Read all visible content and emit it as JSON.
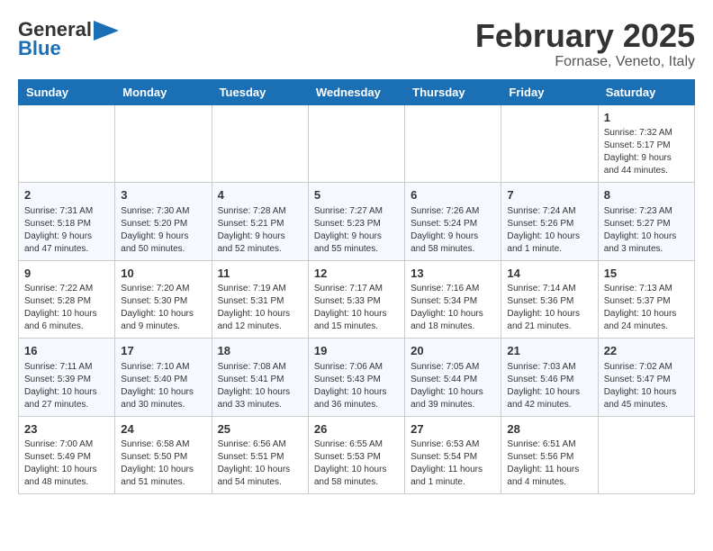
{
  "header": {
    "logo_line1": "General",
    "logo_line2": "Blue",
    "title": "February 2025",
    "subtitle": "Fornase, Veneto, Italy"
  },
  "calendar": {
    "days_of_week": [
      "Sunday",
      "Monday",
      "Tuesday",
      "Wednesday",
      "Thursday",
      "Friday",
      "Saturday"
    ],
    "weeks": [
      [
        {
          "day": "",
          "info": ""
        },
        {
          "day": "",
          "info": ""
        },
        {
          "day": "",
          "info": ""
        },
        {
          "day": "",
          "info": ""
        },
        {
          "day": "",
          "info": ""
        },
        {
          "day": "",
          "info": ""
        },
        {
          "day": "1",
          "info": "Sunrise: 7:32 AM\nSunset: 5:17 PM\nDaylight: 9 hours and 44 minutes."
        }
      ],
      [
        {
          "day": "2",
          "info": "Sunrise: 7:31 AM\nSunset: 5:18 PM\nDaylight: 9 hours and 47 minutes."
        },
        {
          "day": "3",
          "info": "Sunrise: 7:30 AM\nSunset: 5:20 PM\nDaylight: 9 hours and 50 minutes."
        },
        {
          "day": "4",
          "info": "Sunrise: 7:28 AM\nSunset: 5:21 PM\nDaylight: 9 hours and 52 minutes."
        },
        {
          "day": "5",
          "info": "Sunrise: 7:27 AM\nSunset: 5:23 PM\nDaylight: 9 hours and 55 minutes."
        },
        {
          "day": "6",
          "info": "Sunrise: 7:26 AM\nSunset: 5:24 PM\nDaylight: 9 hours and 58 minutes."
        },
        {
          "day": "7",
          "info": "Sunrise: 7:24 AM\nSunset: 5:26 PM\nDaylight: 10 hours and 1 minute."
        },
        {
          "day": "8",
          "info": "Sunrise: 7:23 AM\nSunset: 5:27 PM\nDaylight: 10 hours and 3 minutes."
        }
      ],
      [
        {
          "day": "9",
          "info": "Sunrise: 7:22 AM\nSunset: 5:28 PM\nDaylight: 10 hours and 6 minutes."
        },
        {
          "day": "10",
          "info": "Sunrise: 7:20 AM\nSunset: 5:30 PM\nDaylight: 10 hours and 9 minutes."
        },
        {
          "day": "11",
          "info": "Sunrise: 7:19 AM\nSunset: 5:31 PM\nDaylight: 10 hours and 12 minutes."
        },
        {
          "day": "12",
          "info": "Sunrise: 7:17 AM\nSunset: 5:33 PM\nDaylight: 10 hours and 15 minutes."
        },
        {
          "day": "13",
          "info": "Sunrise: 7:16 AM\nSunset: 5:34 PM\nDaylight: 10 hours and 18 minutes."
        },
        {
          "day": "14",
          "info": "Sunrise: 7:14 AM\nSunset: 5:36 PM\nDaylight: 10 hours and 21 minutes."
        },
        {
          "day": "15",
          "info": "Sunrise: 7:13 AM\nSunset: 5:37 PM\nDaylight: 10 hours and 24 minutes."
        }
      ],
      [
        {
          "day": "16",
          "info": "Sunrise: 7:11 AM\nSunset: 5:39 PM\nDaylight: 10 hours and 27 minutes."
        },
        {
          "day": "17",
          "info": "Sunrise: 7:10 AM\nSunset: 5:40 PM\nDaylight: 10 hours and 30 minutes."
        },
        {
          "day": "18",
          "info": "Sunrise: 7:08 AM\nSunset: 5:41 PM\nDaylight: 10 hours and 33 minutes."
        },
        {
          "day": "19",
          "info": "Sunrise: 7:06 AM\nSunset: 5:43 PM\nDaylight: 10 hours and 36 minutes."
        },
        {
          "day": "20",
          "info": "Sunrise: 7:05 AM\nSunset: 5:44 PM\nDaylight: 10 hours and 39 minutes."
        },
        {
          "day": "21",
          "info": "Sunrise: 7:03 AM\nSunset: 5:46 PM\nDaylight: 10 hours and 42 minutes."
        },
        {
          "day": "22",
          "info": "Sunrise: 7:02 AM\nSunset: 5:47 PM\nDaylight: 10 hours and 45 minutes."
        }
      ],
      [
        {
          "day": "23",
          "info": "Sunrise: 7:00 AM\nSunset: 5:49 PM\nDaylight: 10 hours and 48 minutes."
        },
        {
          "day": "24",
          "info": "Sunrise: 6:58 AM\nSunset: 5:50 PM\nDaylight: 10 hours and 51 minutes."
        },
        {
          "day": "25",
          "info": "Sunrise: 6:56 AM\nSunset: 5:51 PM\nDaylight: 10 hours and 54 minutes."
        },
        {
          "day": "26",
          "info": "Sunrise: 6:55 AM\nSunset: 5:53 PM\nDaylight: 10 hours and 58 minutes."
        },
        {
          "day": "27",
          "info": "Sunrise: 6:53 AM\nSunset: 5:54 PM\nDaylight: 11 hours and 1 minute."
        },
        {
          "day": "28",
          "info": "Sunrise: 6:51 AM\nSunset: 5:56 PM\nDaylight: 11 hours and 4 minutes."
        },
        {
          "day": "",
          "info": ""
        }
      ]
    ]
  }
}
